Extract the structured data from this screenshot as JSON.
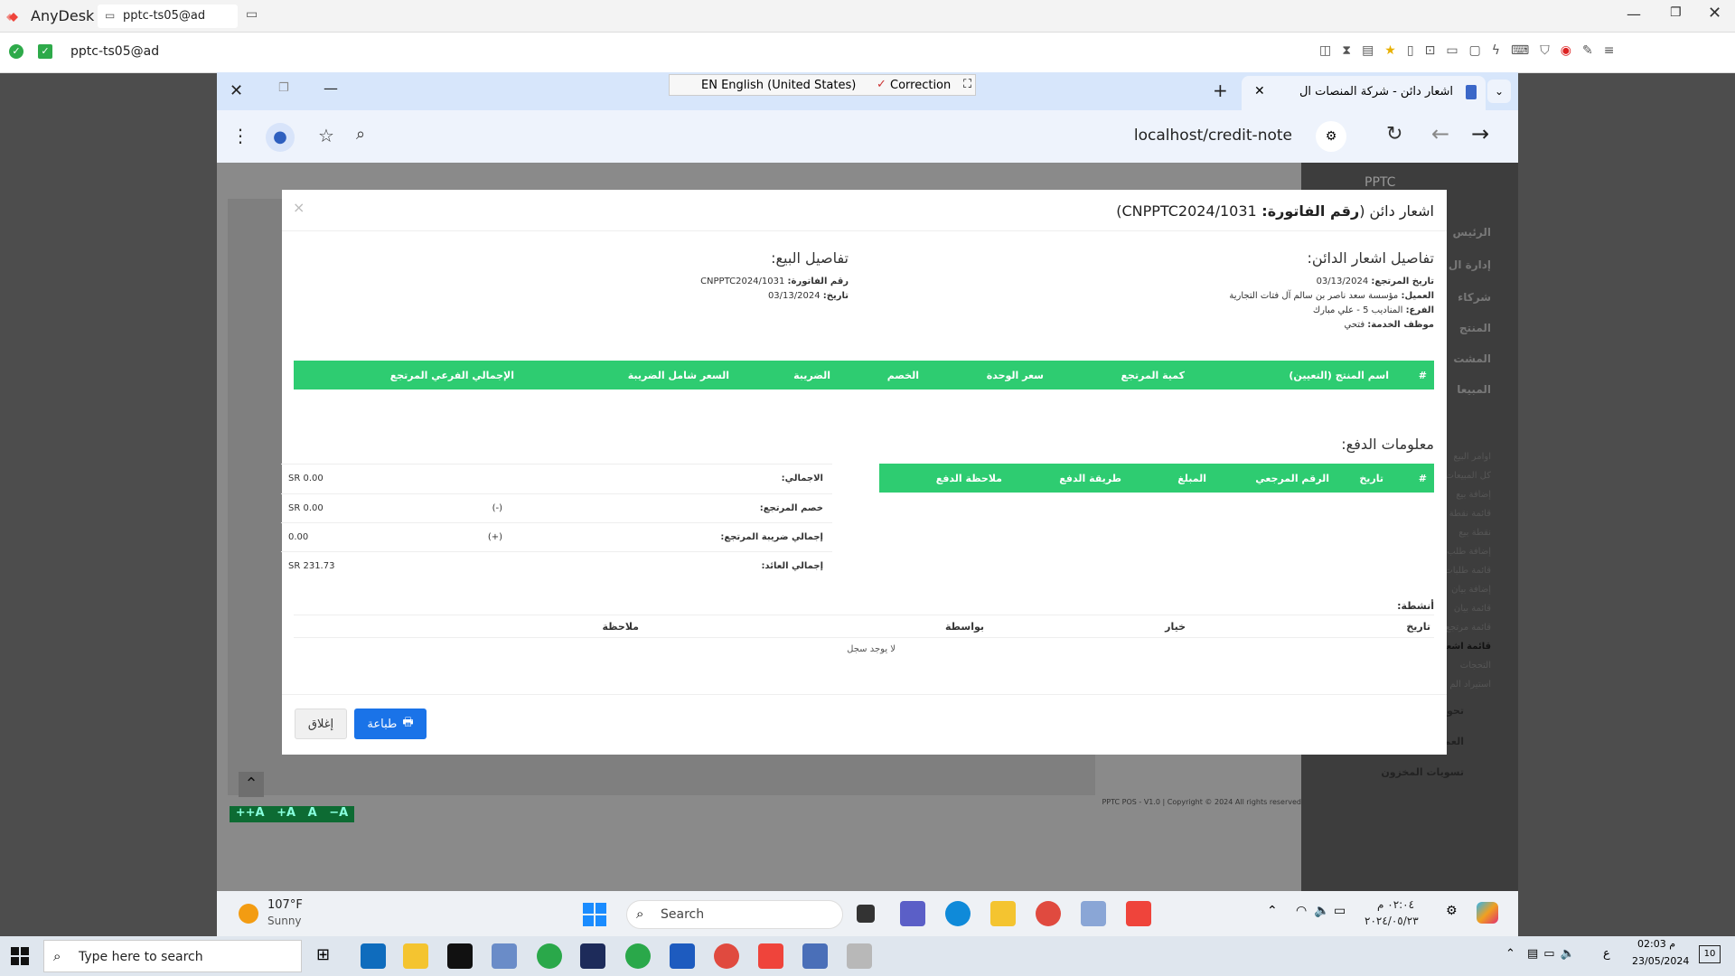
{
  "anydesk": {
    "app_name": "AnyDesk",
    "tab_label": "pptc-ts05@ad",
    "address": "pptc-ts05@ad"
  },
  "langbar": {
    "lang": "EN English (United States)",
    "correction": "Correction"
  },
  "browser": {
    "tab_title": "اشعار دائن - شركة المنصات ال",
    "url": "localhost/credit-note"
  },
  "modal": {
    "title_prefix": "اشعار دائن (",
    "title_bold": "رقم الفاتورة: ",
    "title_value": "CNPPTC2024/1031)",
    "close_x": "×",
    "credit_heading": "تفاصيل اشعار الدائن:",
    "credit": {
      "date_label": "تاريخ المرتجع:",
      "date_value": "03/13/2024",
      "client_label": "العميل:",
      "client_value": "مؤسسة سعد ناصر بن سالم آل فتات التجارية",
      "branch_label": "الفرع:",
      "branch_value": "المناديب 5 - علي مبارك",
      "staff_label": "موظف الخدمة:",
      "staff_value": "فتحي"
    },
    "sale_heading": "تفاصيل البيع:",
    "sale": {
      "invoice_label": "رقم الفاتورة:",
      "invoice_value": "CNPPTC2024/1031",
      "date_label": "تاريخ:",
      "date_value": "03/13/2024"
    },
    "products_headers": [
      "#",
      "اسم المنتج (التعيين)",
      "كمية المرتجع",
      "سعر الوحدة",
      "الخصم",
      "الضريبة",
      "السعر شامل الضريبة",
      "الإجمالي الفرعي المرتجع"
    ],
    "payment_heading": "معلومات الدفع:",
    "payment_headers": [
      "#",
      "تاريخ",
      "الرقم المرجعي",
      "المبلغ",
      "طريقة الدفع",
      "ملاحظة الدفع"
    ],
    "totals": [
      {
        "label": "الاجمالي:",
        "sign": "",
        "value": "SR 0.00"
      },
      {
        "label": "خصم المرتجع:",
        "sign": "(-)",
        "value": "SR 0.00"
      },
      {
        "label": "إجمالي ضريبة المرتجع:",
        "sign": "(+)",
        "value": "0.00"
      },
      {
        "label": "إجمالي العائد:",
        "sign": "",
        "value": "SR 231.73"
      }
    ],
    "activities_heading": "أنشطة:",
    "activities_headers": [
      "تاريخ",
      "خيار",
      "بواسطة",
      "ملاحظة"
    ],
    "no_record": "لا يوجد سجل",
    "print_button": "طباعة",
    "close_button": "إغلاق"
  },
  "sidebar": {
    "brand": "PPTC",
    "items": [
      "الرئيس",
      "إدارة ال",
      "شركاء",
      "المنتج",
      "المشت",
      "المبيعا"
    ],
    "subitems": [
      "اوامر البيع",
      "كل المبيعات",
      "إضافة بيع",
      "قائمة نقطة",
      "نقطة بيع",
      "إضافة طلب",
      "قائمة طلبات",
      "إضافة بيان",
      "قائمة بيان",
      "قائمة مرتجع",
      "قائمة اشعا",
      "التحجات",
      "استيراد الم"
    ],
    "bottom_items": [
      "تحويلات المخزون",
      "العمولات",
      "تسويات المخزون"
    ]
  },
  "app": {
    "footer": "PPTC POS - V1.0 | Copyright © 2024 All rights reserved",
    "font_controls": [
      "++A",
      "+A",
      "A",
      "−A"
    ]
  },
  "remote_taskbar": {
    "weather_temp": "107°F",
    "weather_desc": "Sunny",
    "search": "Search",
    "time": "٠٢:٠٤ م",
    "date": "٢٠٢٤/٠٥/٢٣",
    "lang": "ع"
  },
  "local_taskbar": {
    "search_placeholder": "Type here to search",
    "time": "02:03 م",
    "date": "23/05/2024",
    "notif": "10"
  },
  "colors": {
    "green": "#2ecc71",
    "blue": "#1a73e8",
    "anydesk_red": "#ef443b"
  }
}
